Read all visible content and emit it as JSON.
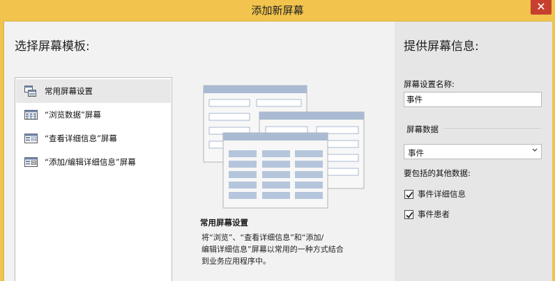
{
  "window": {
    "title": "添加新屏幕",
    "close_glyph": "✕"
  },
  "left_panel": {
    "heading": "选择屏幕模板:",
    "templates": [
      {
        "label": "常用屏幕设置",
        "icon": "common-screen-icon",
        "selected": true
      },
      {
        "label": "“浏览数据”屏幕",
        "icon": "browse-data-icon",
        "selected": false
      },
      {
        "label": "“查看详细信息”屏幕",
        "icon": "details-icon",
        "selected": false
      },
      {
        "label": "“添加/编辑详细信息”屏幕",
        "icon": "add-edit-icon",
        "selected": false
      }
    ],
    "preview_title": "常用屏幕设置",
    "preview_desc_lines": [
      "将“浏览”、“查看详细信息”和“添加/",
      "编辑详细信息”屏幕以常用的一种方式结合",
      "到业务应用程序中。"
    ]
  },
  "right_panel": {
    "heading": "提供屏幕信息:",
    "name_label": "屏幕设置名称:",
    "name_value": "事件",
    "data_group_label": "屏幕数据",
    "data_value": "事件",
    "extra_label": "要包括的其他数据:",
    "checkboxes": [
      {
        "label": "事件详细信息",
        "checked": true
      },
      {
        "label": "事件患者",
        "checked": true
      }
    ]
  },
  "colors": {
    "titlebar": "#f2c44d",
    "close": "#c7402f",
    "preview_header": "#a9bad2",
    "preview_grid": "#b5c5db"
  }
}
